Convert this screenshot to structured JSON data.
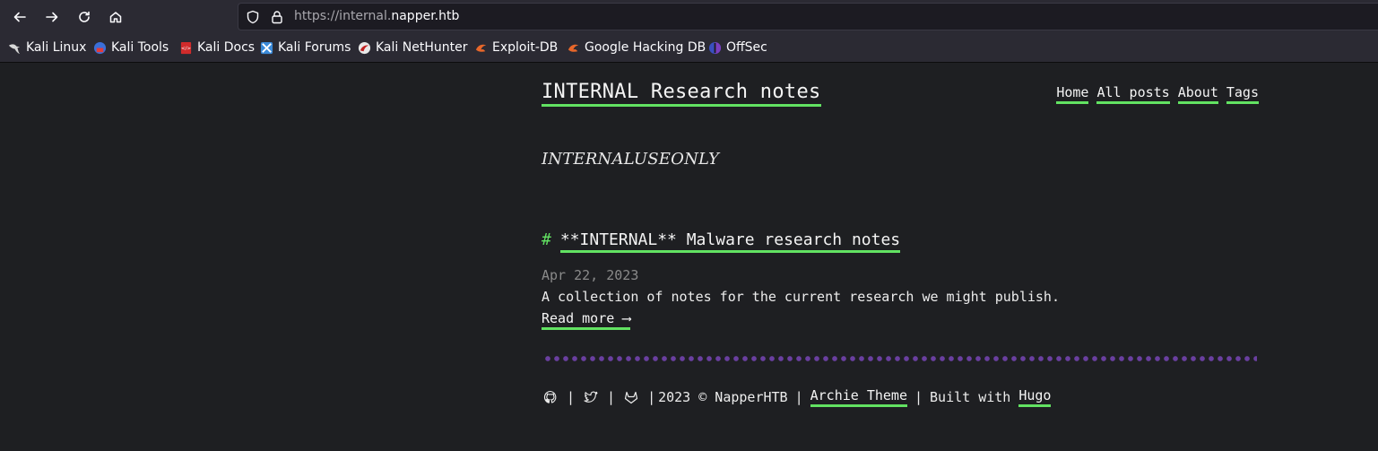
{
  "browser": {
    "url_prefix": "https://internal.",
    "url_domain": "napper.htb",
    "bookmarks": [
      {
        "label": "Kali Linux",
        "icon": "kali-dragon-icon"
      },
      {
        "label": "Kali Tools",
        "icon": "kali-tools-icon"
      },
      {
        "label": "Kali Docs",
        "icon": "kali-docs-icon"
      },
      {
        "label": "Kali Forums",
        "icon": "kali-forums-icon"
      },
      {
        "label": "Kali NetHunter",
        "icon": "kali-nethunter-icon"
      },
      {
        "label": "Exploit-DB",
        "icon": "exploit-db-icon"
      },
      {
        "label": "Google Hacking DB",
        "icon": "ghdb-icon"
      },
      {
        "label": "OffSec",
        "icon": "offsec-icon"
      }
    ]
  },
  "site": {
    "title": "INTERNAL Research notes",
    "subtitle": "INTERNALUSEONLY",
    "nav": [
      "Home",
      "All posts",
      "About",
      "Tags"
    ]
  },
  "post": {
    "hash": "#",
    "title": "**INTERNAL** Malware research notes",
    "date": "Apr 22, 2023",
    "summary": "A collection of notes for the current research we might publish.",
    "read_more": "Read more ⟶"
  },
  "footer": {
    "copyright": "2023 © NapperHTB",
    "pipe": "|",
    "theme_link": "Archie Theme",
    "built_with": "Built with",
    "hugo_link": "Hugo"
  },
  "colors": {
    "accent": "#62e262",
    "background": "#1e1f22",
    "divider": "#6a3fa0"
  }
}
